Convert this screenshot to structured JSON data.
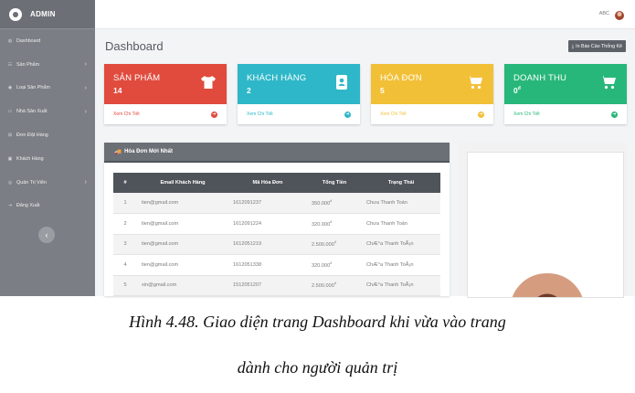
{
  "sidebar": {
    "brand": "ADMIN",
    "items": [
      {
        "label": "Dashboard",
        "icon": "dashboard-icon",
        "glyph": "◍",
        "has_sub": false
      },
      {
        "label": "Sản Phẩm",
        "icon": "products-icon",
        "glyph": "☷",
        "has_sub": true
      },
      {
        "label": "Loại Sản Phẩm",
        "icon": "categories-icon",
        "glyph": "◉",
        "has_sub": true
      },
      {
        "label": "Nhà Sản Xuất",
        "icon": "manufacturer-icon",
        "glyph": "▭",
        "has_sub": true
      },
      {
        "label": "Đơn Đặt Hàng",
        "icon": "cart-icon",
        "glyph": "⊞",
        "has_sub": false
      },
      {
        "label": "Khách Hàng",
        "icon": "customers-icon",
        "glyph": "▣",
        "has_sub": false
      },
      {
        "label": "Quản Trị Viên",
        "icon": "admins-icon",
        "glyph": "◎",
        "has_sub": true
      },
      {
        "label": "Đăng Xuất",
        "icon": "logout-icon",
        "glyph": "⇥",
        "has_sub": false
      }
    ],
    "collapse_glyph": "‹"
  },
  "topbar": {
    "user": "ABC"
  },
  "page": {
    "title": "Dashboard",
    "report_button": "In Báo Cáo Thống Kê",
    "report_icon": "download-icon"
  },
  "cards": [
    {
      "title": "SẢN PHẨM",
      "value": "14",
      "unit": "",
      "link": "Xem Chi Tiết",
      "icon": "shirt-icon",
      "color": "#e04b3d"
    },
    {
      "title": "KHÁCH HÀNG",
      "value": "2",
      "unit": "",
      "link": "Xem Chi Tiết",
      "icon": "contact-card-icon",
      "color": "#2eb7c8"
    },
    {
      "title": "HÓA ĐƠN",
      "value": "5",
      "unit": "",
      "link": "Xem Chi Tiết",
      "icon": "cart-icon",
      "color": "#f2c037"
    },
    {
      "title": "DOANH THU",
      "value": "0",
      "unit": "đ",
      "link": "Xem Chi Tiết",
      "icon": "cart-icon",
      "color": "#28b77a"
    }
  ],
  "orders": {
    "title": "Hóa Đơn Mới Nhất",
    "icon": "truck-icon",
    "columns": [
      "#",
      "Email Khách Hàng",
      "Mã Hóa Đơn",
      "Tổng Tiền",
      "Trạng Thái"
    ],
    "rows": [
      {
        "n": "1",
        "email": "tien@gmail.com",
        "code": "1612091237",
        "total": "350.000",
        "currency": "đ",
        "status": "Chưa Thanh Toán"
      },
      {
        "n": "2",
        "email": "tien@gmail.com",
        "code": "1612091224",
        "total": "320.000",
        "currency": "đ",
        "status": "Chưa Thanh Toán"
      },
      {
        "n": "3",
        "email": "tien@gmail.com",
        "code": "1612051219",
        "total": "2.500.000",
        "currency": "đ",
        "status": "ChÆ°a Thanh ToÃ¡n"
      },
      {
        "n": "4",
        "email": "tien@gmail.com",
        "code": "1612051338",
        "total": "320.000",
        "currency": "đ",
        "status": "ChÆ°a Thanh ToÃ¡n"
      },
      {
        "n": "5",
        "email": "xin@gmail.com",
        "code": "1512051207",
        "total": "2.500.000",
        "currency": "đ",
        "status": "ChÆ°a Thanh ToÃ¡n"
      }
    ]
  },
  "caption": {
    "line1": "Hình 4.48. Giao diện trang Dashboard khi vừa vào trang",
    "line2": "dành cho người quản trị"
  }
}
